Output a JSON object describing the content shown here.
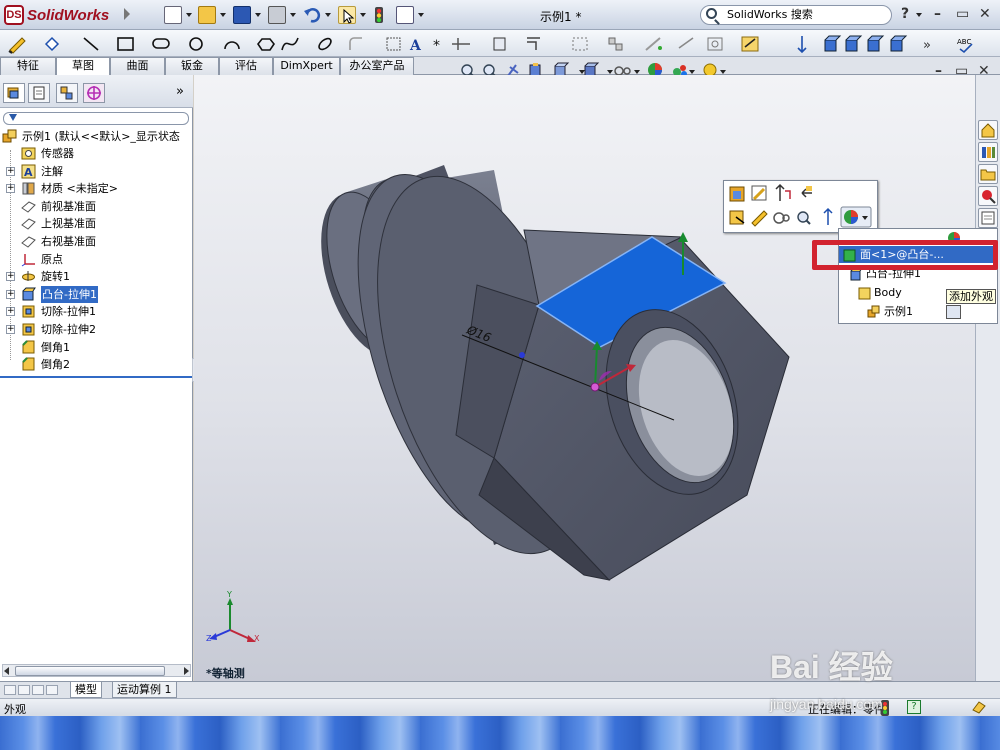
{
  "app": {
    "logo_text": "SolidWorks",
    "doc_title": "示例1 *",
    "search_placeholder": "SolidWorks 搜索",
    "help_label": "?",
    "min_label": "–",
    "max_label": "▭",
    "close_label": "✕",
    "more_label": "»"
  },
  "command_tabs": [
    "特征",
    "草图",
    "曲面",
    "钣金",
    "评估",
    "DimXpert",
    "办公室产品"
  ],
  "active_tab": "草图",
  "feature_tree": {
    "root": "示例1  (默认<<默认>_显示状态",
    "items": [
      {
        "label": "传感器",
        "icon": "sensor-icon",
        "expandable": false
      },
      {
        "label": "注解",
        "icon": "annotation-icon",
        "expandable": true
      },
      {
        "label": "材质 <未指定>",
        "icon": "material-icon",
        "expandable": true
      },
      {
        "label": "前视基准面",
        "icon": "plane-icon",
        "expandable": false
      },
      {
        "label": "上视基准面",
        "icon": "plane-icon",
        "expandable": false
      },
      {
        "label": "右视基准面",
        "icon": "plane-icon",
        "expandable": false
      },
      {
        "label": "原点",
        "icon": "origin-icon",
        "expandable": false
      },
      {
        "label": "旋转1",
        "icon": "revolve-icon",
        "expandable": true
      },
      {
        "label": "凸台-拉伸1",
        "icon": "extrude-icon",
        "expandable": true,
        "selected": true
      },
      {
        "label": "切除-拉伸1",
        "icon": "cut-extrude-icon",
        "expandable": true
      },
      {
        "label": "切除-拉伸2",
        "icon": "cut-extrude-icon",
        "expandable": true
      },
      {
        "label": "倒角1",
        "icon": "chamfer-icon",
        "expandable": false
      },
      {
        "label": "倒角2",
        "icon": "chamfer-icon",
        "expandable": false
      }
    ]
  },
  "viewport": {
    "dimension_label": "Ø16",
    "view_name": "*等轴测",
    "triad": {
      "x": "X",
      "y": "Y",
      "z": "Z"
    }
  },
  "selection_list": {
    "items": [
      {
        "label": "面<1>@凸台-...",
        "icon": "face-icon",
        "highlight": true
      },
      {
        "label": "凸台-拉伸1",
        "icon": "extrude-icon"
      },
      {
        "label": "Body",
        "icon": "body-icon"
      },
      {
        "label": "示例1",
        "icon": "part-icon"
      }
    ],
    "tooltip": "添加外观"
  },
  "bottom_tabs": [
    "模型",
    "运动算例 1"
  ],
  "active_bottom_tab": "模型",
  "status": {
    "left": "外观",
    "editing": "正在编辑：零件",
    "help": "?"
  },
  "watermark": {
    "main": "Bai 经验",
    "url": "jingyan.baidu.com"
  },
  "colors": {
    "selection_blue": "#316ac5",
    "selected_face": "#1565d8",
    "part_body": "#5a5f70",
    "highlight_red": "#d2232f"
  }
}
